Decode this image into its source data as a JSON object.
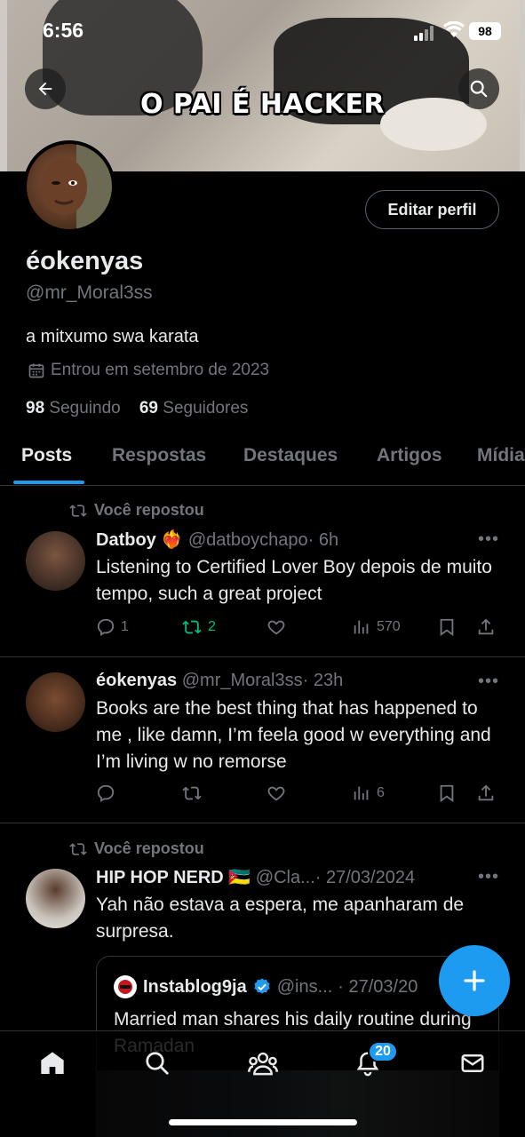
{
  "status_bar": {
    "time": "6:56",
    "battery": "98"
  },
  "banner": {
    "caption": "O PAI É HACKER"
  },
  "profile": {
    "edit_label": "Editar perfil",
    "display_name": "éokenyas",
    "handle": "@mr_Moral3ss",
    "bio": "a mitxumo swa karata",
    "joined": "Entrou em setembro de 2023",
    "following_count": "98",
    "following_label": "Seguindo",
    "followers_count": "69",
    "followers_label": "Seguidores"
  },
  "tabs": [
    "Posts",
    "Respostas",
    "Destaques",
    "Artigos",
    "Mídia"
  ],
  "posts": [
    {
      "repost_label": "Você repostou",
      "name": "Datboy ❤️‍🔥",
      "handle": "@datboychapo",
      "time": "· 6h",
      "text": "Listening to Certified Lover Boy depois de muito tempo, such a great project",
      "replies": "1",
      "reposts": "2",
      "likes": "",
      "views": "570"
    },
    {
      "repost_label": "",
      "name": "éokenyas",
      "handle": "@mr_Moral3ss",
      "time": "· 23h",
      "text": "Books are the best thing that has happened to me , like damn, I’m feela good w everything and I’m living w no remorse",
      "replies": "",
      "reposts": "",
      "likes": "",
      "views": "6"
    },
    {
      "repost_label": "Você repostou",
      "name": "HIP HOP NERD 🇲🇿",
      "handle": "@Cla...",
      "time": "· 27/03/2024",
      "text": "Yah não estava a espera, me apanharam de surpresa."
    }
  ],
  "quote": {
    "name": "Instablog9ja",
    "handle": "@ins...",
    "time": "· 27/03/20",
    "text": "Married man shares his daily routine during Ramadan"
  },
  "nav": {
    "notifications_badge": "20"
  },
  "colors": {
    "accent": "#1d9bf0",
    "repost_green": "#00ba7c",
    "muted": "#71767b"
  }
}
